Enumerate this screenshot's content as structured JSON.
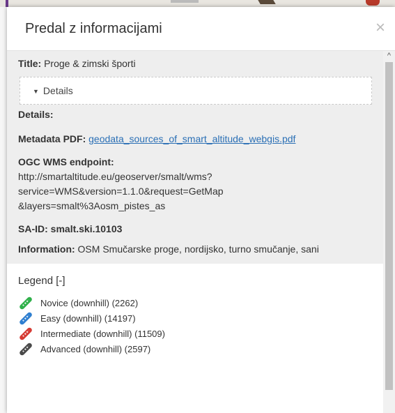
{
  "panel": {
    "title": "Predal z informacijami",
    "close_label": "×"
  },
  "meta": {
    "title_label": "Title:",
    "title_value": "Proge & zimski športi",
    "details_toggle": "Details",
    "details_heading": "Details:",
    "pdf_label": "Metadata PDF:",
    "pdf_link": "geodata_sources_of_smart_altitude_webgis.pdf",
    "wms_label": "OGC WMS endpoint:",
    "wms_line1": "http://smartaltitude.eu/geoserver/smalt/wms?",
    "wms_line2": "service=WMS&version=1.1.0&request=GetMap",
    "wms_line3": "&layers=smalt%3Aosm_pistes_as",
    "said_label": "SA-ID:",
    "said_value": "smalt.ski.10103",
    "info_label": "Information:",
    "info_value": "OSM Smučarske proge, nordijsko, turno smučanje, sani"
  },
  "legend": {
    "title": "Legend [-]",
    "items": [
      {
        "label": "Novice (downhill) (2262)",
        "color": "#2fb04a"
      },
      {
        "label": "Easy (downhill) (14197)",
        "color": "#2f7fd0"
      },
      {
        "label": "Intermediate (downhill) (11509)",
        "color": "#d63b34"
      },
      {
        "label": "Advanced (downhill) (2597)",
        "color": "#4a4a4a"
      }
    ]
  },
  "scrollbar": {
    "up_arrow": "^"
  }
}
